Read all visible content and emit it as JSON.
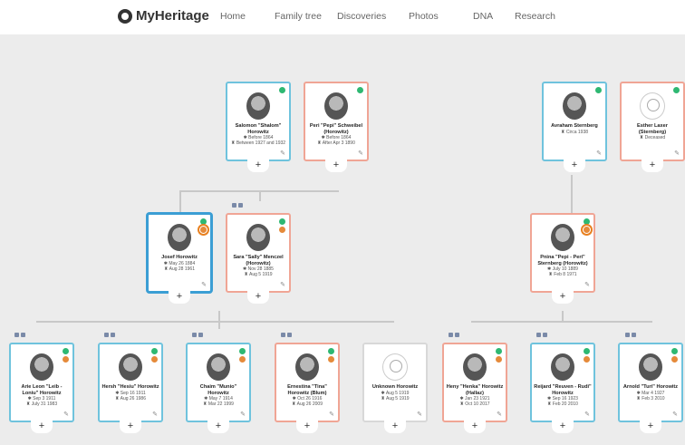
{
  "header": {
    "logo": "MyHeritage",
    "nav": [
      "Home",
      "Family tree",
      "Discoveries",
      "Photos",
      "DNA",
      "Research"
    ]
  },
  "people": [
    {
      "name": "Salomon \"Shalom\" Horowitz",
      "d1": "✱ Before 1864",
      "d2": "♜ Between 1927 and 1932"
    },
    {
      "name": "Peri \"Pepi\" Schweibel (Horowitz)",
      "d1": "✱ Before 1864",
      "d2": "♜ After Apr 3 1890"
    },
    {
      "name": "Avraham Sternberg",
      "d1": "♜ Circa 1938",
      "d2": ""
    },
    {
      "name": "Esther Laxer (Sternberg)",
      "d1": "♜ Deceased",
      "d2": ""
    },
    {
      "name": "Josef Horowitz",
      "d1": "✱ May 26 1884",
      "d2": "♜ Aug 28 1961"
    },
    {
      "name": "Sara \"Sally\" Menczel (Horowitz)",
      "d1": "✱ Nov 28 1885",
      "d2": "♜ Aug 5 1919"
    },
    {
      "name": "Pnina \"Pepi - Peri\" Sternberg (Horowitz)",
      "d1": "✱ July 10 1889",
      "d2": "♜ Feb 8 1971"
    },
    {
      "name": "Arie Leon \"Leib - Loniu\" Horowitz",
      "d1": "✱ Sep 3 1911",
      "d2": "♜ July 31 1983"
    },
    {
      "name": "Hersh \"Hesiu\" Horowitz",
      "d1": "✱ Sep 16 1911",
      "d2": "♜ Aug 26 1986"
    },
    {
      "name": "Chaim \"Munio\" Horowitz",
      "d1": "✱ May 7 1914",
      "d2": "♜ Mar 22 1999"
    },
    {
      "name": "Ernestina \"Tina\" Horowitz (Blum)",
      "d1": "✱ Oct 26 1916",
      "d2": "♜ Aug 26 2009"
    },
    {
      "name": "Unknown Horowitz",
      "d1": "✱ Aug 5 1919",
      "d2": "♜ Aug 5 1919"
    },
    {
      "name": "Heny \"Henka\" Horowitz (Hallaz)",
      "d1": "✱ Jan 23 1921",
      "d2": "♜ Oct 10 2017"
    },
    {
      "name": "Reijard \"Reuven - Rudi\" Horowitz",
      "d1": "✱ Sep 16 1923",
      "d2": "♜ Feb 20 2010"
    },
    {
      "name": "Arnold \"Turi\" Horowitz",
      "d1": "✱ Mar 4 1927",
      "d2": "♜ Feb 3 2010"
    }
  ],
  "controls": {
    "plus": "+",
    "edit": "✎"
  },
  "colors": {
    "male_border": "#6fc3dd",
    "female_border": "#f0a595",
    "highlight": "#e8801f",
    "smart_match": "#2eb872"
  }
}
